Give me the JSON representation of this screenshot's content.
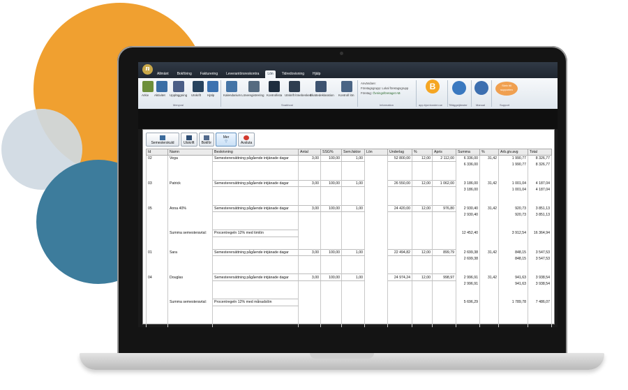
{
  "decor": {
    "orange": "#f0a030",
    "light": "#cfd9e2",
    "blue": "#3d7c9c"
  },
  "app": {
    "logo": "n",
    "tabs": [
      "Allmänt",
      "Bokföring",
      "Fakturering",
      "Leverantörsreskontra",
      "Lön",
      "Tidredovisning",
      "Hjälp"
    ],
    "active_tab": "Lön",
    "ribbon": {
      "buttons": [
        "Arkiv",
        "Aktivitet",
        "Uppläggning",
        "Utskrift",
        "Hjälp",
        "Kalendarium",
        "Löneregistrering",
        "Kontrollista",
        "Utskrift lönebesked",
        "Skattedeklaration",
        "Kontroll lön"
      ],
      "groups": [
        "Menyval",
        "Snabbval",
        "Information",
        "app.bjornlunden.se",
        "Tilläggstjänster",
        "Manual",
        "Support"
      ],
      "info": {
        "user": "Användare:",
        "group": "Företagsgrupp:",
        "group_value": "Lokal företagsgrupp",
        "company": "Företag:",
        "company_value": "Övningsföretaget AB"
      },
      "support_badge": "Skriv till supporten"
    },
    "toolbar": {
      "semesterskuld": "Semesterskuld",
      "utskrift": "Utskrift",
      "bokfor": "Bokför",
      "mer": "Mer",
      "avsluta": "Avsluta"
    }
  },
  "table": {
    "headers": [
      "Id",
      "Namn",
      "Beskrivning",
      "Antal",
      "SSG%",
      "Sem.faktor",
      "Lön",
      "Underlag",
      "%",
      "Apris",
      "Summa",
      "%",
      "Arb.giv.avg",
      "Total"
    ],
    "rows": [
      [
        "02",
        "Vega",
        "Semesterersättning pågående intjänade dagar",
        "3,00",
        "100,00",
        "1,00",
        "",
        "52 800,00",
        "12,00",
        "2 112,00",
        "6 336,00",
        "31,42",
        "1 990,77",
        "8 326,77"
      ],
      [
        "",
        "",
        "",
        "",
        "",
        "",
        "",
        "",
        "",
        "",
        "6 336,00",
        "",
        "1 990,77",
        "8 326,77"
      ],
      [
        "",
        "",
        "",
        "",
        "",
        "",
        "",
        "",
        "",
        "",
        "",
        "",
        "",
        ""
      ],
      [
        "",
        "",
        "",
        "",
        "",
        "",
        "",
        "",
        "",
        "",
        "",
        "",
        "",
        ""
      ],
      [
        "03",
        "Patrick",
        "Semesterersättning pågående intjänade dagar",
        "3,00",
        "100,00",
        "1,00",
        "",
        "26 550,00",
        "12,00",
        "1 062,00",
        "3 186,00",
        "31,42",
        "1 001,04",
        "4 187,04"
      ],
      [
        "",
        "",
        "",
        "",
        "",
        "",
        "",
        "",
        "",
        "",
        "3 186,00",
        "",
        "1 001,04",
        "4 187,04"
      ],
      [
        "",
        "",
        "",
        "",
        "",
        "",
        "",
        "",
        "",
        "",
        "",
        "",
        "",
        ""
      ],
      [
        "",
        "",
        "",
        "",
        "",
        "",
        "",
        "",
        "",
        "",
        "",
        "",
        "",
        ""
      ],
      [
        "05",
        "Anna 40%",
        "Semesterersättning pågående intjänade dagar",
        "3,00",
        "100,00",
        "1,00",
        "",
        "24 420,00",
        "12,00",
        "976,80",
        "2 930,40",
        "31,42",
        "920,73",
        "3 851,13"
      ],
      [
        "",
        "",
        "",
        "",
        "",
        "",
        "",
        "",
        "",
        "",
        "2 930,40",
        "",
        "920,73",
        "3 851,13"
      ],
      [
        "",
        "",
        "",
        "",
        "",
        "",
        "",
        "",
        "",
        "",
        "",
        "",
        "",
        ""
      ],
      [
        "",
        "",
        "",
        "",
        "",
        "",
        "",
        "",
        "",
        "",
        "",
        "",
        "",
        ""
      ],
      [
        "",
        "Summa semesteravtal:",
        "Procentregeln 12% med timlön",
        "",
        "",
        "",
        "",
        "",
        "",
        "",
        "12 452,40",
        "",
        "3 912,54",
        "16 364,94"
      ],
      [
        "",
        "",
        "",
        "",
        "",
        "",
        "",
        "",
        "",
        "",
        "",
        "",
        "",
        ""
      ],
      [
        "",
        "",
        "",
        "",
        "",
        "",
        "",
        "",
        "",
        "",
        "",
        "",
        "",
        ""
      ],
      [
        "01",
        "Sara",
        "Semesterersättning pågående intjänade dagar",
        "3,00",
        "100,00",
        "1,00",
        "",
        "22 494,82",
        "12,00",
        "899,79",
        "2 699,38",
        "31,42",
        "848,15",
        "3 547,53"
      ],
      [
        "",
        "",
        "",
        "",
        "",
        "",
        "",
        "",
        "",
        "",
        "2 699,38",
        "",
        "848,15",
        "3 547,53"
      ],
      [
        "",
        "",
        "",
        "",
        "",
        "",
        "",
        "",
        "",
        "",
        "",
        "",
        "",
        ""
      ],
      [
        "",
        "",
        "",
        "",
        "",
        "",
        "",
        "",
        "",
        "",
        "",
        "",
        "",
        ""
      ],
      [
        "04",
        "Douglas",
        "Semesterersättning pågående intjänade dagar",
        "3,00",
        "100,00",
        "1,00",
        "",
        "24 974,24",
        "12,00",
        "998,97",
        "2 996,91",
        "31,42",
        "941,63",
        "3 938,54"
      ],
      [
        "",
        "",
        "",
        "",
        "",
        "",
        "",
        "",
        "",
        "",
        "2 996,91",
        "",
        "941,63",
        "3 938,54"
      ],
      [
        "",
        "",
        "",
        "",
        "",
        "",
        "",
        "",
        "",
        "",
        "",
        "",
        "",
        ""
      ],
      [
        "",
        "",
        "",
        "",
        "",
        "",
        "",
        "",
        "",
        "",
        "",
        "",
        "",
        ""
      ],
      [
        "",
        "Summa semesteravtal:",
        "Procentregeln 12% med månadslön",
        "",
        "",
        "",
        "",
        "",
        "",
        "",
        "5 696,29",
        "",
        "1 789,78",
        "7 486,07"
      ],
      [
        "",
        "",
        "",
        "",
        "",
        "",
        "",
        "",
        "",
        "",
        "",
        "",
        "",
        ""
      ],
      [
        "",
        "",
        "",
        "",
        "",
        "",
        "",
        "",
        "",
        "",
        "",
        "",
        "",
        ""
      ],
      [
        "",
        "",
        "",
        "",
        "",
        "",
        "",
        "",
        "",
        "",
        "",
        "",
        "",
        ""
      ],
      [
        "",
        "",
        "",
        "",
        "",
        "",
        "",
        "",
        "",
        "",
        "",
        "",
        "",
        ""
      ],
      [
        "",
        "",
        "",
        "",
        "",
        "",
        "",
        "",
        "",
        "",
        "",
        "",
        "",
        ""
      ]
    ]
  }
}
